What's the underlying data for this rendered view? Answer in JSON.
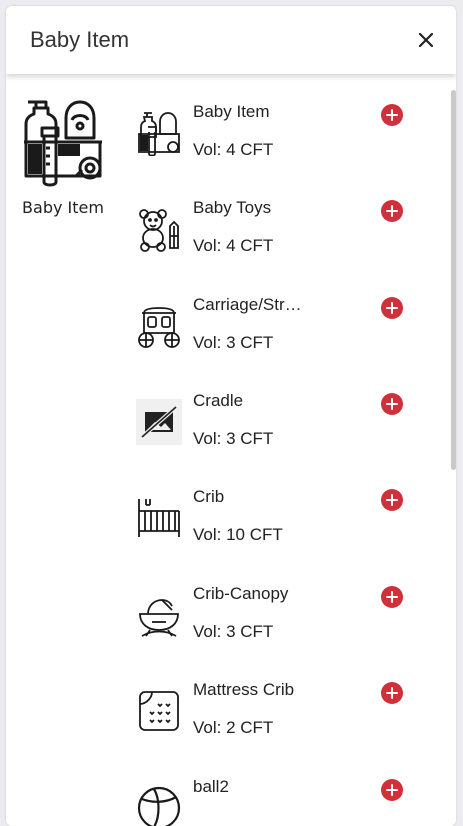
{
  "dialog": {
    "title": "Baby Item",
    "close_label": "×"
  },
  "category": {
    "label": "Baby Item",
    "icon": "baby-items-icon"
  },
  "items": [
    {
      "name": "Baby Item",
      "volume": "Vol: 4 CFT",
      "icon": "baby-items-icon"
    },
    {
      "name": "Baby Toys",
      "volume": "Vol: 4 CFT",
      "icon": "teddy-bear-icon"
    },
    {
      "name": "Carriage/Str…",
      "volume": "Vol: 3 CFT",
      "icon": "carriage-icon"
    },
    {
      "name": "Cradle",
      "volume": "Vol: 3 CFT",
      "icon": "image-placeholder-icon"
    },
    {
      "name": "Crib",
      "volume": "Vol: 10 CFT",
      "icon": "crib-icon"
    },
    {
      "name": "Crib-Canopy",
      "volume": "Vol: 3 CFT",
      "icon": "crib-canopy-icon"
    },
    {
      "name": "Mattress Crib",
      "volume": "Vol: 2 CFT",
      "icon": "mattress-icon"
    },
    {
      "name": "ball2",
      "volume": "",
      "icon": "ball-icon"
    }
  ],
  "colors": {
    "add_button": "#d0303a",
    "background": "#ececf0"
  }
}
